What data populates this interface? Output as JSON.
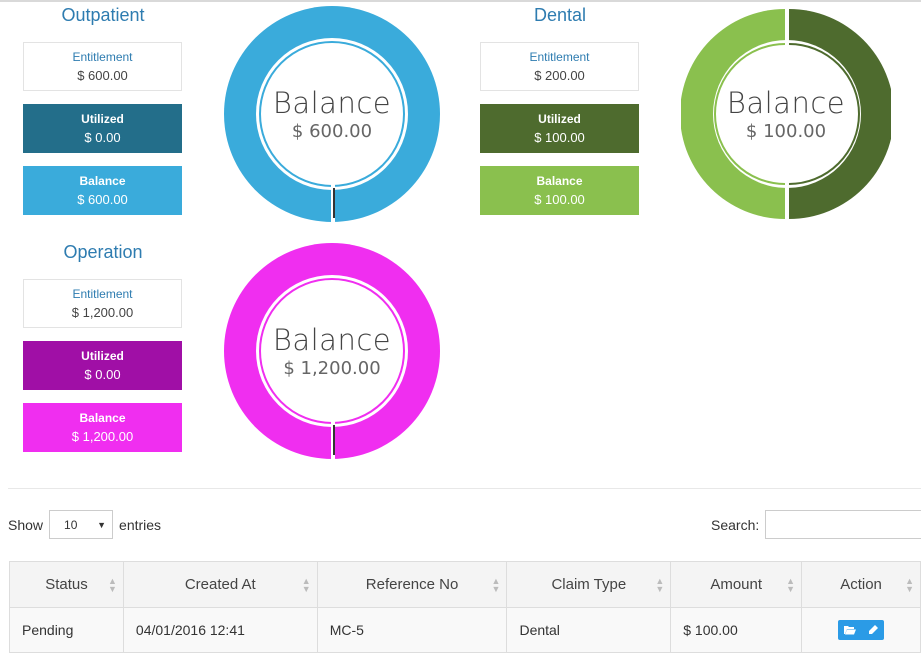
{
  "cards": [
    {
      "id": "outpatient",
      "title": "Outpatient",
      "entitlement_label": "Entitlement",
      "entitlement_value": "$ 600.00",
      "utilized_label": "Utilized",
      "utilized_value": "$ 0.00",
      "balance_label": "Balance",
      "balance_value": "$ 600.00",
      "donut_title": "Balance",
      "donut_value": "$ 600.00",
      "donut_fraction_balance": 1.0,
      "colors": {
        "utilized": "#236e8a",
        "balance": "#3aabdb"
      }
    },
    {
      "id": "dental",
      "title": "Dental",
      "entitlement_label": "Entitlement",
      "entitlement_value": "$ 200.00",
      "utilized_label": "Utilized",
      "utilized_value": "$ 100.00",
      "balance_label": "Balance",
      "balance_value": "$ 100.00",
      "donut_title": "Balance",
      "donut_value": "$ 100.00",
      "donut_fraction_balance": 0.5,
      "colors": {
        "utilized": "#4e6b2e",
        "balance": "#8ac04e"
      }
    },
    {
      "id": "operation",
      "title": "Operation",
      "entitlement_label": "Entitlement",
      "entitlement_value": "$ 1,200.00",
      "utilized_label": "Utilized",
      "utilized_value": "$ 0.00",
      "balance_label": "Balance",
      "balance_value": "$ 1,200.00",
      "donut_title": "Balance",
      "donut_value": "$ 1,200.00",
      "donut_fraction_balance": 1.0,
      "colors": {
        "utilized": "#a00fa6",
        "balance": "#f02ef0"
      }
    }
  ],
  "table_controls": {
    "show_label": "Show",
    "entries_value": "10",
    "entries_label": "entries",
    "search_label": "Search:",
    "search_value": ""
  },
  "table": {
    "headers": [
      "Status",
      "Created At",
      "Reference No",
      "Claim Type",
      "Amount",
      "Action"
    ],
    "rows": [
      {
        "status": "Pending",
        "created_at": "04/01/2016 12:41",
        "reference_no": "MC-5",
        "claim_type": "Dental",
        "amount": "$ 100.00"
      }
    ],
    "action_icons": [
      "folder-open-icon",
      "pencil-icon"
    ]
  }
}
